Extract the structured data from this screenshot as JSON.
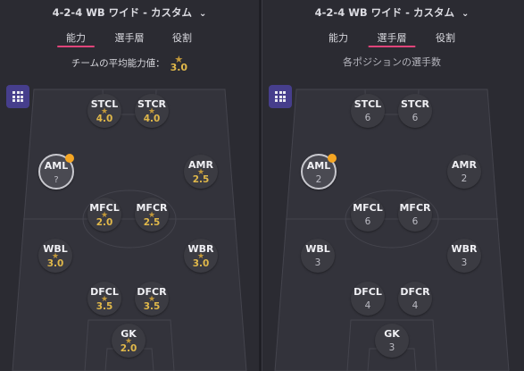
{
  "formation": {
    "label": "4-2-4 WB ワイド - カスタム",
    "chevron_icon": "chevron-down-icon"
  },
  "tabs": [
    "能力",
    "選手層",
    "役割"
  ],
  "left": {
    "active_tab": "能力",
    "summary_label": "チームの平均能力値：",
    "summary_value": "3.0",
    "positions": [
      {
        "code": "STCL",
        "value": "4.0"
      },
      {
        "code": "STCR",
        "value": "4.0"
      },
      {
        "code": "AML",
        "value": "?"
      },
      {
        "code": "AMR",
        "value": "2.5"
      },
      {
        "code": "MFCL",
        "value": "2.0"
      },
      {
        "code": "MFCR",
        "value": "2.5"
      },
      {
        "code": "WBL",
        "value": "3.0"
      },
      {
        "code": "WBR",
        "value": "3.0"
      },
      {
        "code": "DFCL",
        "value": "3.5"
      },
      {
        "code": "DFCR",
        "value": "3.5"
      },
      {
        "code": "GK",
        "value": "2.0"
      }
    ]
  },
  "right": {
    "active_tab": "選手層",
    "caption": "各ポジションの選手数",
    "positions": [
      {
        "code": "STCL",
        "count": "6"
      },
      {
        "code": "STCR",
        "count": "6"
      },
      {
        "code": "AML",
        "count": "2"
      },
      {
        "code": "AMR",
        "count": "2"
      },
      {
        "code": "MFCL",
        "count": "6"
      },
      {
        "code": "MFCR",
        "count": "6"
      },
      {
        "code": "WBL",
        "count": "3"
      },
      {
        "code": "WBR",
        "count": "3"
      },
      {
        "code": "DFCL",
        "count": "4"
      },
      {
        "code": "DFCR",
        "count": "4"
      },
      {
        "code": "GK",
        "count": "3"
      }
    ]
  },
  "colors": {
    "accent_underline": "#e0457a",
    "star": "#c49a3a",
    "rating": "#e0b84a",
    "notification": "#f5a623",
    "view_button": "#463e8c"
  }
}
